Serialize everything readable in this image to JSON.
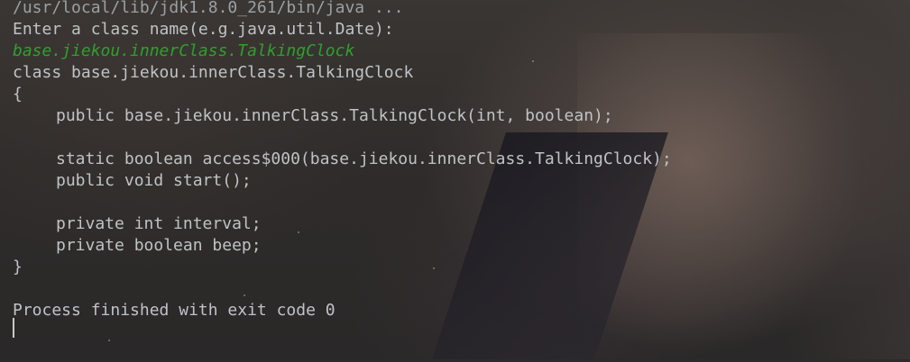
{
  "console": {
    "command_line": "/usr/local/lib/jdk1.8.0_261/bin/java ...",
    "prompt": "Enter a class name(e.g.java.util.Date):",
    "user_input": "base.jiekou.innerClass.TalkingClock",
    "class_header": "class base.jiekou.innerClass.TalkingClock",
    "open_brace": "{",
    "constructor": "public base.jiekou.innerClass.TalkingClock(int, boolean);",
    "method_access": "static boolean access$000(base.jiekou.innerClass.TalkingClock);",
    "method_start": "public void start();",
    "field_interval": "private int interval;",
    "field_beep": "private boolean beep;",
    "close_brace": "}",
    "exit_message": "Process finished with exit code 0"
  },
  "colors": {
    "text": "#bfc3c6",
    "user_input": "#2fa02b",
    "background": "#2b2b2b"
  }
}
